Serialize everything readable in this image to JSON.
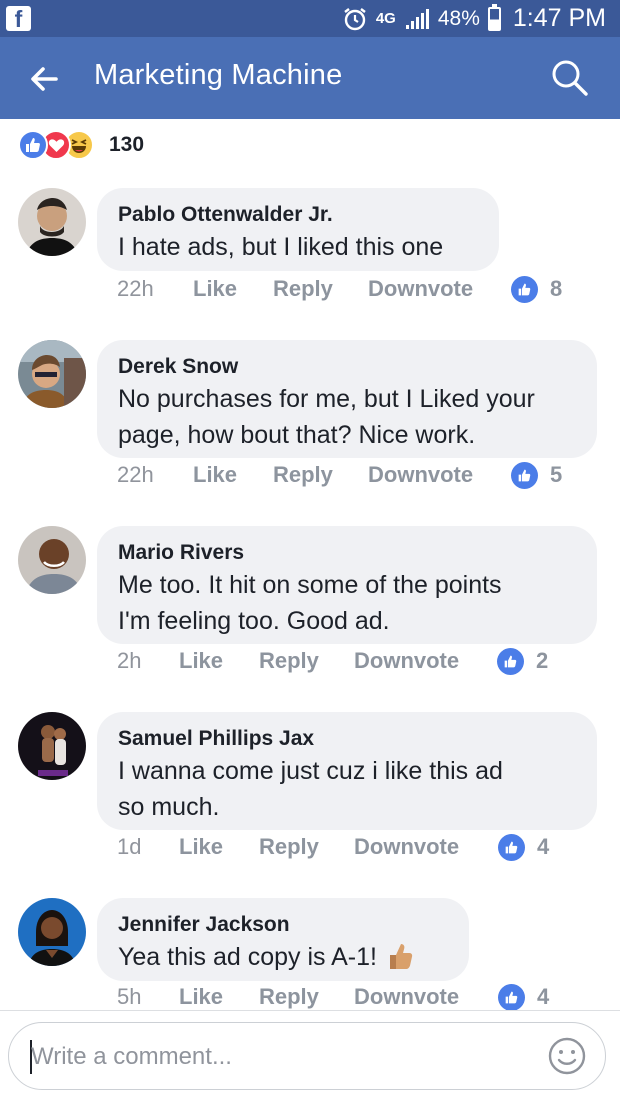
{
  "status_bar": {
    "app_icon": "facebook-icon",
    "network": "4G",
    "battery_percent": "48%",
    "time": "1:47 PM"
  },
  "app_bar": {
    "title": "Marketing Machine",
    "back_icon": "arrow-left-icon",
    "search_icon": "search-icon"
  },
  "reactions": {
    "types": [
      "like",
      "love",
      "haha"
    ],
    "count": "130"
  },
  "comments": [
    {
      "author": "Pablo Ottenwalder Jr.",
      "lines": [
        "I hate ads, but I liked this one"
      ],
      "time": "22h",
      "like": "Like",
      "reply": "Reply",
      "downvote": "Downvote",
      "likes": "8"
    },
    {
      "author": "Derek Snow",
      "lines": [
        "No purchases for me, but I Liked your",
        "page, how bout that? Nice work."
      ],
      "time": "22h",
      "like": "Like",
      "reply": "Reply",
      "downvote": "Downvote",
      "likes": "5"
    },
    {
      "author": "Mario Rivers",
      "lines": [
        "Me too. It hit on some of the points",
        "I'm feeling too. Good ad."
      ],
      "time": "2h",
      "like": "Like",
      "reply": "Reply",
      "downvote": "Downvote",
      "likes": "2"
    },
    {
      "author": "Samuel Phillips Jax",
      "lines": [
        "I wanna come just cuz i like this ad",
        "so much."
      ],
      "time": "1d",
      "like": "Like",
      "reply": "Reply",
      "downvote": "Downvote",
      "likes": "4"
    },
    {
      "author": "Jennifer Jackson",
      "lines": [
        "Yea this ad copy is A-1!"
      ],
      "time": "5h",
      "like": "Like",
      "reply": "Reply",
      "downvote": "Downvote",
      "likes": "4"
    }
  ],
  "composer": {
    "placeholder": "Write a comment...",
    "emoji_icon": "smiley-icon"
  },
  "colors": {
    "status_bar": "#3b5998",
    "app_bar": "#4a6fb5",
    "bubble": "#f0f1f4",
    "like_blue": "#4b7de8",
    "love_red": "#f0384d",
    "haha_yellow": "#f7c84a"
  }
}
